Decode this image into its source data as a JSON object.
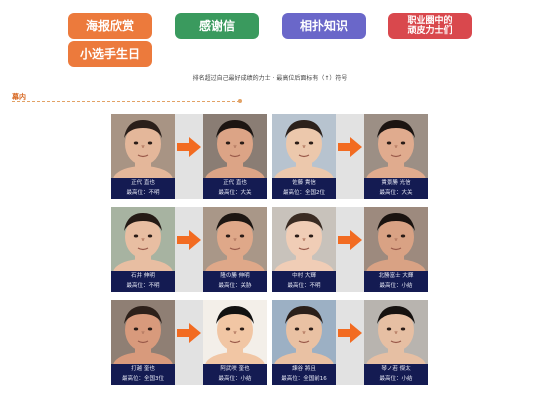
{
  "nav": {
    "buttons": [
      {
        "label": "海报欣赏"
      },
      {
        "label": "感谢信"
      },
      {
        "label": "相扑知识"
      },
      {
        "label_line1": "职业圈中的",
        "label_line2": "顽皮力士们"
      },
      {
        "label": "小选手生日"
      }
    ]
  },
  "note": "排名超过自己最好成绩的力士 · 最高位后面标有（↑）符号",
  "section": {
    "label": "幕内"
  },
  "rows": [
    [
      {
        "name": "正代 直也",
        "rank": "最高位：不明",
        "bg": "#a89484",
        "skin": "#e4b79a",
        "hair": "#2a1f1a"
      },
      {
        "name": "正代 直也",
        "rank": "最高位：大关",
        "bg": "#8a7d74",
        "skin": "#dca486",
        "hair": "#1c1512"
      },
      {
        "name": "佐藤 貴信",
        "rank": "最高位：全国2位",
        "bg": "#b7c3cf",
        "skin": "#ecc8ac",
        "hair": "#2c211b"
      },
      {
        "name": "貴景勝 光信",
        "rank": "最高位：大关",
        "bg": "#9c8f85",
        "skin": "#e0ab8e",
        "hair": "#1b1411"
      }
    ],
    [
      {
        "name": "石井 伸明",
        "rank": "最高位：不明",
        "bg": "#a7b3a1",
        "skin": "#e8bea2",
        "hair": "#241a15"
      },
      {
        "name": "隆の勝 伸明",
        "rank": "最高位：关胁",
        "bg": "#a99788",
        "skin": "#dfa889",
        "hair": "#1d1612"
      },
      {
        "name": "中村 大輝",
        "rank": "最高位：不明",
        "bg": "#c8c2bb",
        "skin": "#f0cdb6",
        "hair": "#3a2b22"
      },
      {
        "name": "北勝富士 大輝",
        "rank": "最高位：小结",
        "bg": "#9d8a7e",
        "skin": "#d9a284",
        "hair": "#1a1310"
      }
    ],
    [
      {
        "name": "打越 奎也",
        "rank": "最高位：全国3位",
        "bg": "#8f7f74",
        "skin": "#d89a7c",
        "hair": "#2d201a"
      },
      {
        "name": "阿武咲 奎也",
        "rank": "最高位：小结",
        "bg": "#f3efe9",
        "skin": "#f1c6a4",
        "hair": "#111111"
      },
      {
        "name": "諫谷 將且",
        "rank": "最高位：全国前16",
        "bg": "#9cb0c4",
        "skin": "#e9c1a3",
        "hair": "#2a1f19"
      },
      {
        "name": "琴ノ若 傑太",
        "rank": "最高位：小结",
        "bg": "#b8b4af",
        "skin": "#e6bfa3",
        "hair": "#161210"
      }
    ]
  ],
  "arrow_color": "#f26b21"
}
